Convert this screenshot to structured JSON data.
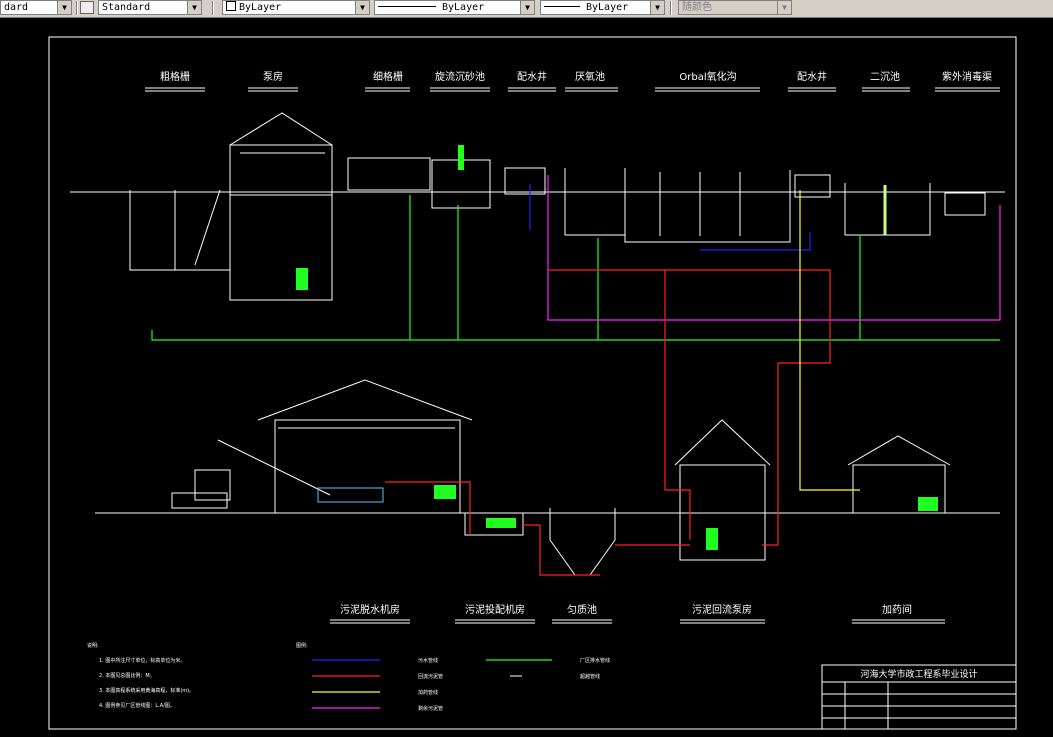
{
  "toolbar": {
    "style_partial": "dard",
    "dimstyle": "Standard",
    "layer_color": "ByLayer",
    "linetype": "ByLayer",
    "lineweight": "ByLayer",
    "plotstyle": "随颜色"
  },
  "labels": {
    "top": [
      "粗格栅",
      "泵房",
      "细格栅",
      "旋流沉砂池",
      "配水井",
      "厌氧池",
      "Orbal氧化沟",
      "配水井",
      "二沉池",
      "紫外消毒渠"
    ],
    "bottom": [
      "污泥脱水机房",
      "污泥投配机房",
      "匀质池",
      "污泥回流泵房",
      "加药间"
    ]
  },
  "notes": {
    "title": "说明:",
    "lines": [
      "1. 图中所注尺寸单位，标高单位为米。",
      "2. 本图见总图比例：M。",
      "3. 本图高程系统采用黄海高程，标准(m)。",
      "4. 图例参见厂区管线图：L.A/图。"
    ]
  },
  "legend": {
    "title": "图例:",
    "items": [
      {
        "label": "污水管线",
        "color": "#2020ff"
      },
      {
        "label": "回流污泥管",
        "color": "#ff2020"
      },
      {
        "label": "加药管线",
        "color": "#ffff20"
      },
      {
        "label": "剩余污泥管",
        "color": "#ff20ff"
      },
      {
        "label": "厂区排水管线",
        "color": "#20ff20"
      },
      {
        "label": "超越管线",
        "color": "#ffffff"
      }
    ]
  },
  "titleblock": {
    "title": "河海大学市政工程系毕业设计"
  },
  "colors": {
    "wastewater": "#2020ff",
    "sludge_return": "#ff2020",
    "chemical": "#ffff20",
    "excess_sludge": "#ff20ff",
    "drain": "#20ff20",
    "structure": "#ffffff"
  }
}
